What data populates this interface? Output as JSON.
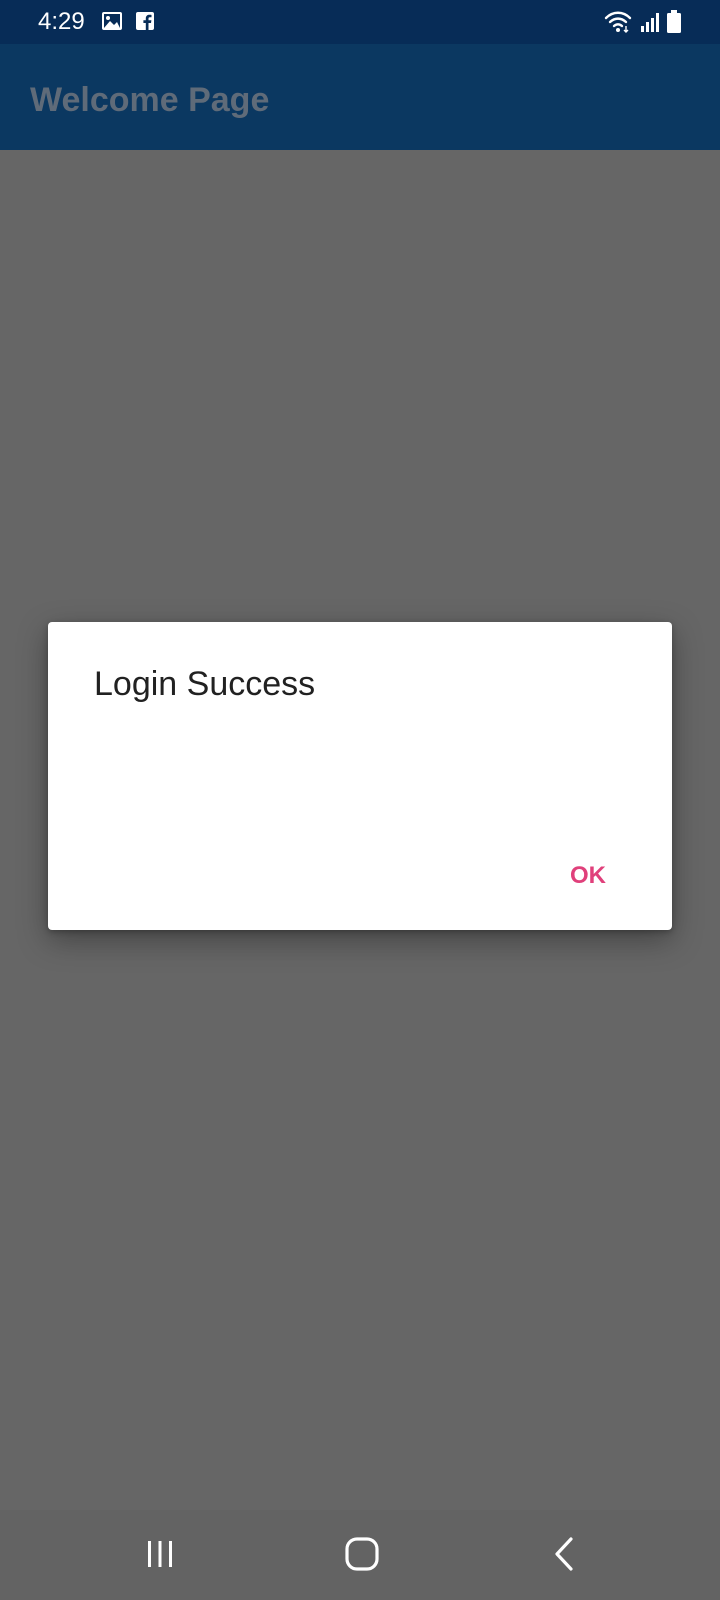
{
  "status_bar": {
    "time": "4:29",
    "icons": [
      "gallery-icon",
      "facebook-icon",
      "wifi-icon",
      "signal-icon",
      "battery-icon"
    ]
  },
  "app_bar": {
    "title": "Welcome Page"
  },
  "dialog": {
    "title": "Login Success",
    "ok_label": "OK"
  },
  "nav_bar": {
    "icons": [
      "recents-icon",
      "home-icon",
      "back-icon"
    ]
  },
  "colors": {
    "status_bar": "#072c57",
    "app_bar": "#0b3861",
    "scrim": "#666666",
    "accent": "#e0407b"
  }
}
